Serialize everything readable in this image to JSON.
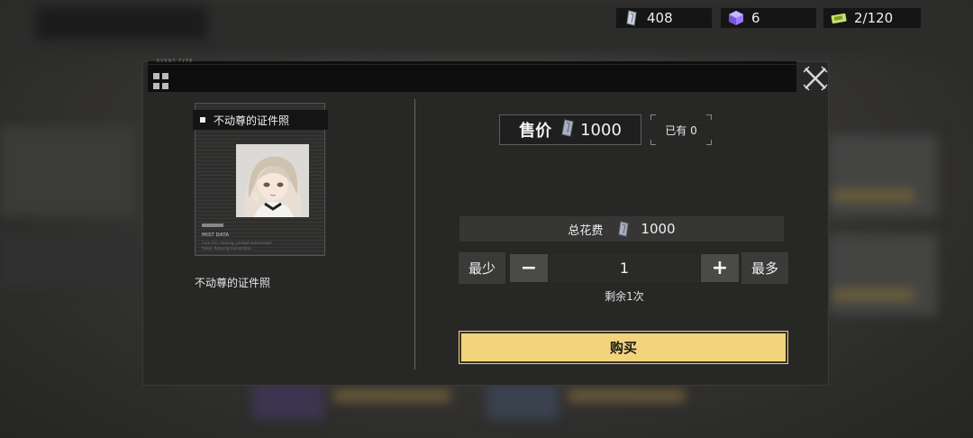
{
  "resources": {
    "fragments": "408",
    "gems": "6",
    "stamina": "2/120"
  },
  "dialog": {
    "header_tag": "EVENT TYPE"
  },
  "item": {
    "card_title": "不动尊的证件照",
    "name": "不动尊的证件照",
    "card_meta_heading": "MIST DATA",
    "card_meta_text": "Core Ctrl. missing, prompt overrunned failed. Retrying Connection..."
  },
  "purchase": {
    "price_label": "售价",
    "price_value": "1000",
    "owned_label": "已有 0",
    "total_label": "总花费",
    "total_value": "1000",
    "min_label": "最少",
    "max_label": "最多",
    "minus_label": "−",
    "plus_label": "+",
    "quantity": "1",
    "remaining": "剩余1次",
    "buy_label": "购买"
  },
  "colors": {
    "buy_button": "#f2d47c",
    "gem": "#9b7bff",
    "stamina": "#c8e06a"
  },
  "icons": {
    "currency": "crystal-shard-icon",
    "gem": "purple-cube-icon",
    "stamina": "ticket-icon",
    "close": "close-icon",
    "menu": "grid-icon"
  }
}
